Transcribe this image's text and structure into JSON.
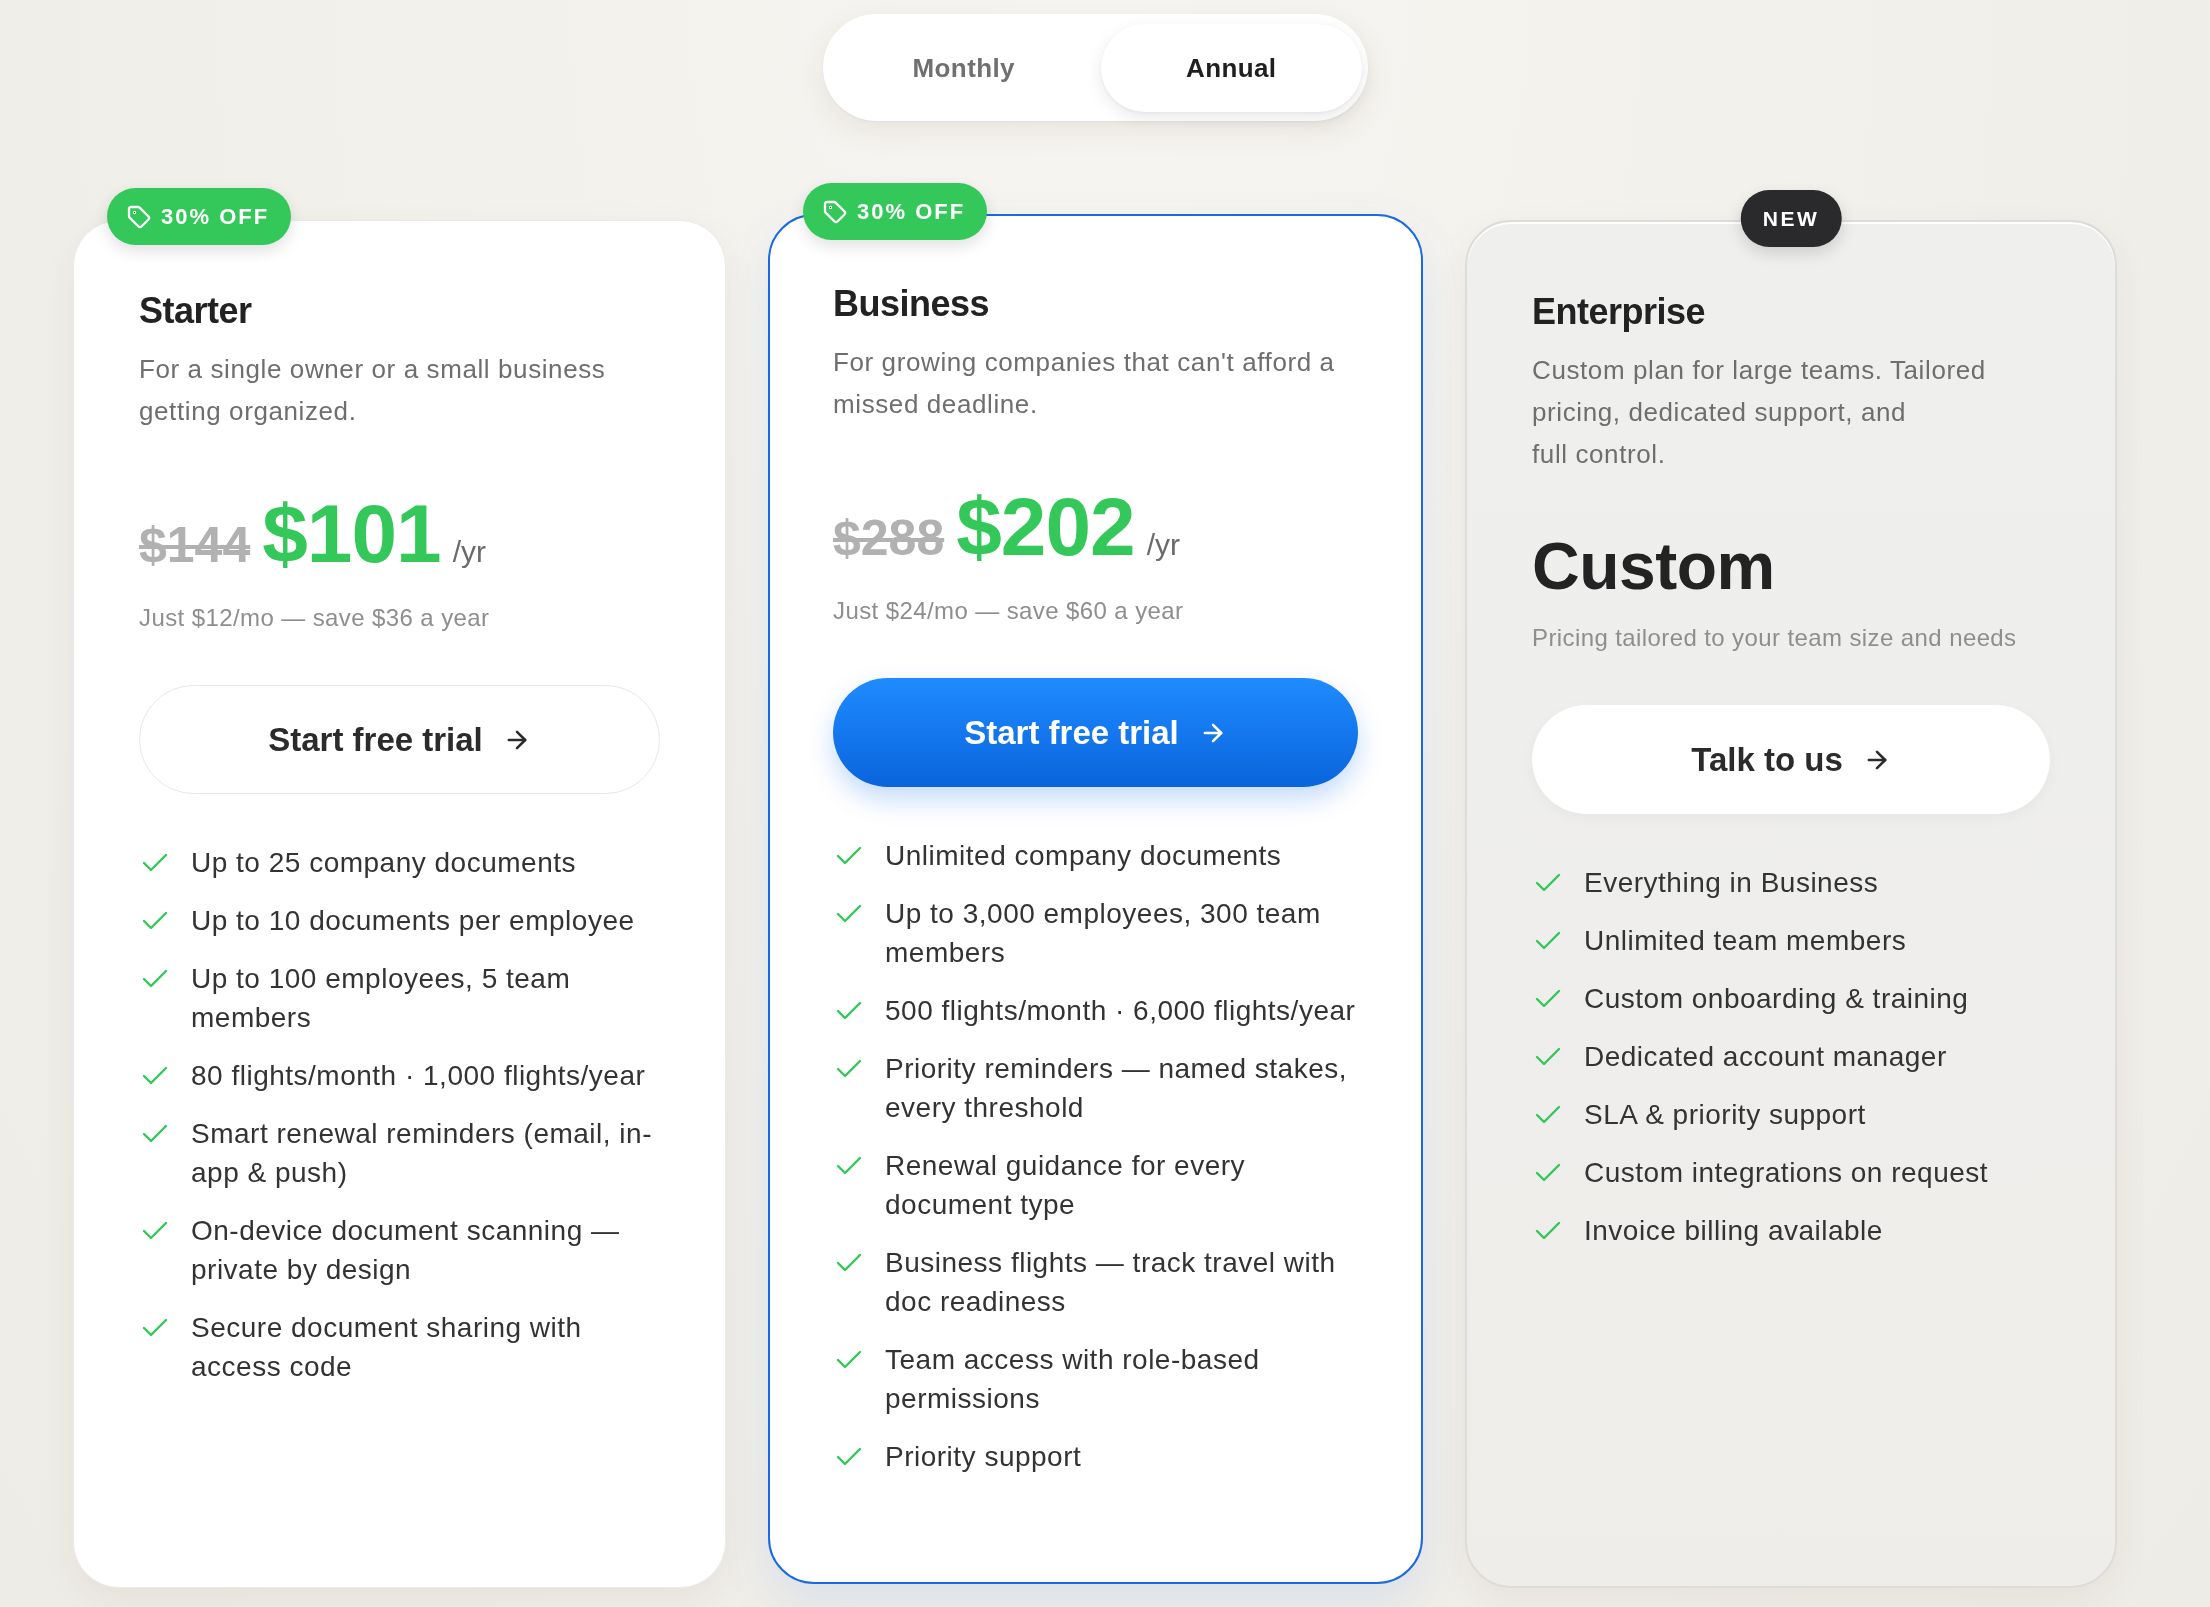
{
  "billing_toggle": [
    {
      "label": "Monthly",
      "selected": false
    },
    {
      "label": "Annual",
      "selected": true
    }
  ],
  "plans": [
    {
      "kind": "discounted",
      "badge": {
        "kind": "discount",
        "text": "30% OFF"
      },
      "featured": false,
      "name": "Starter",
      "description": "For a single owner or a small business getting organized.",
      "old_price": "$144",
      "price": "$101",
      "period": "/yr",
      "note": "Just $12/mo — save $36 a year",
      "cta": "Start free trial",
      "features": [
        "Up to 25 company documents",
        "Up to 10 documents per employee",
        "Up to 100 employees, 5 team members",
        "80 flights/month · 1,000 flights/year",
        "Smart renewal reminders (email, in-app & push)",
        "On-device document scanning — private by design",
        "Secure document sharing with access code"
      ]
    },
    {
      "kind": "discounted",
      "badge": {
        "kind": "discount",
        "text": "30% OFF"
      },
      "featured": true,
      "name": "Business",
      "description": "For growing companies that can't afford a missed deadline.",
      "old_price": "$288",
      "price": "$202",
      "period": "/yr",
      "note": "Just $24/mo — save $60 a year",
      "cta": "Start free trial",
      "features": [
        "Unlimited company documents",
        "Up to 3,000 employees, 300 team members",
        "500 flights/month · 6,000 flights/year",
        "Priority reminders — named stakes, every threshold",
        "Renewal guidance for every document type",
        "Business flights — track travel with doc readiness",
        "Team access with role-based permissions",
        "Priority support"
      ]
    },
    {
      "kind": "custom",
      "badge": {
        "kind": "new",
        "text": "NEW"
      },
      "featured": false,
      "name": "Enterprise",
      "description": "Custom plan for large teams. Tailored pricing, dedicated support, and\nfull control.",
      "price": "Custom",
      "note": "Pricing tailored to your team size and needs",
      "cta": "Talk to us",
      "features": [
        "Everything in Business",
        "Unlimited team members",
        "Custom onboarding & training",
        "Dedicated account manager",
        "SLA & priority support",
        "Custom integrations on request",
        "Invoice billing available"
      ]
    }
  ]
}
